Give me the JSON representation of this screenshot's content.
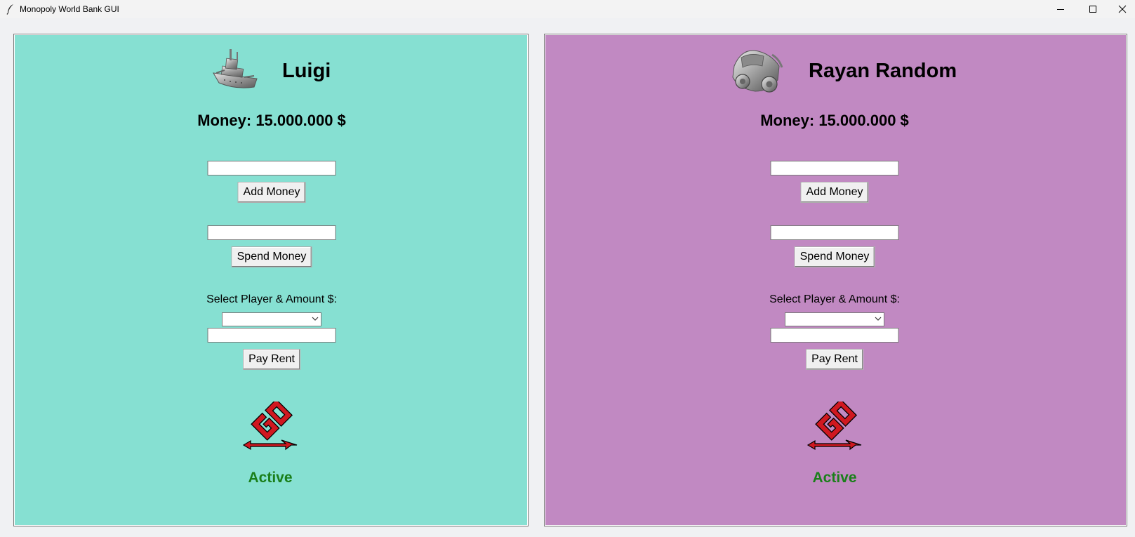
{
  "window": {
    "title": "Monopoly World Bank GUI",
    "app_icon": "feather-icon",
    "controls": [
      "minimize-icon",
      "maximize-icon",
      "close-icon"
    ]
  },
  "colors": {
    "luigi_panel": "#86e0d2",
    "rayan_panel": "#c189c2",
    "status_active": "#1a7f1a",
    "go_red": "#d01820"
  },
  "players": [
    {
      "name": "Luigi",
      "token_icon": "battleship-icon",
      "money_text": "Money: 15.000.000 $",
      "add_input_value": "",
      "add_button_label": "Add Money",
      "spend_input_value": "",
      "spend_button_label": "Spend Money",
      "select_label": "Select Player & Amount $:",
      "select_value": "",
      "rent_input_value": "",
      "rent_button_label": "Pay Rent",
      "go_icon": "go-arrow-icon",
      "status": "Active"
    },
    {
      "name": "Rayan Random",
      "token_icon": "racecar-icon",
      "money_text": "Money: 15.000.000 $",
      "add_input_value": "",
      "add_button_label": "Add Money",
      "spend_input_value": "",
      "spend_button_label": "Spend Money",
      "select_label": "Select Player & Amount $:",
      "select_value": "",
      "rent_input_value": "",
      "rent_button_label": "Pay Rent",
      "go_icon": "go-arrow-icon",
      "status": "Active"
    }
  ]
}
